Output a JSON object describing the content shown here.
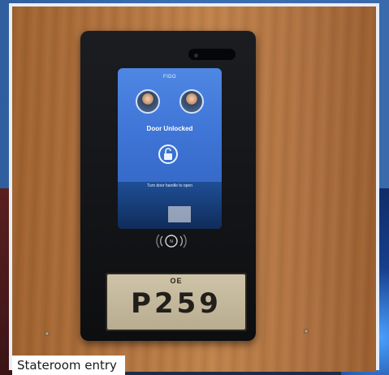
{
  "photo": {
    "screen": {
      "title": "FIDO",
      "status": "Door Unlocked",
      "instruction": "Turn door handle to open"
    },
    "nfc_label": "N",
    "plate": {
      "logo": "OE",
      "number": "P259"
    }
  },
  "caption": "Stateroom entry"
}
